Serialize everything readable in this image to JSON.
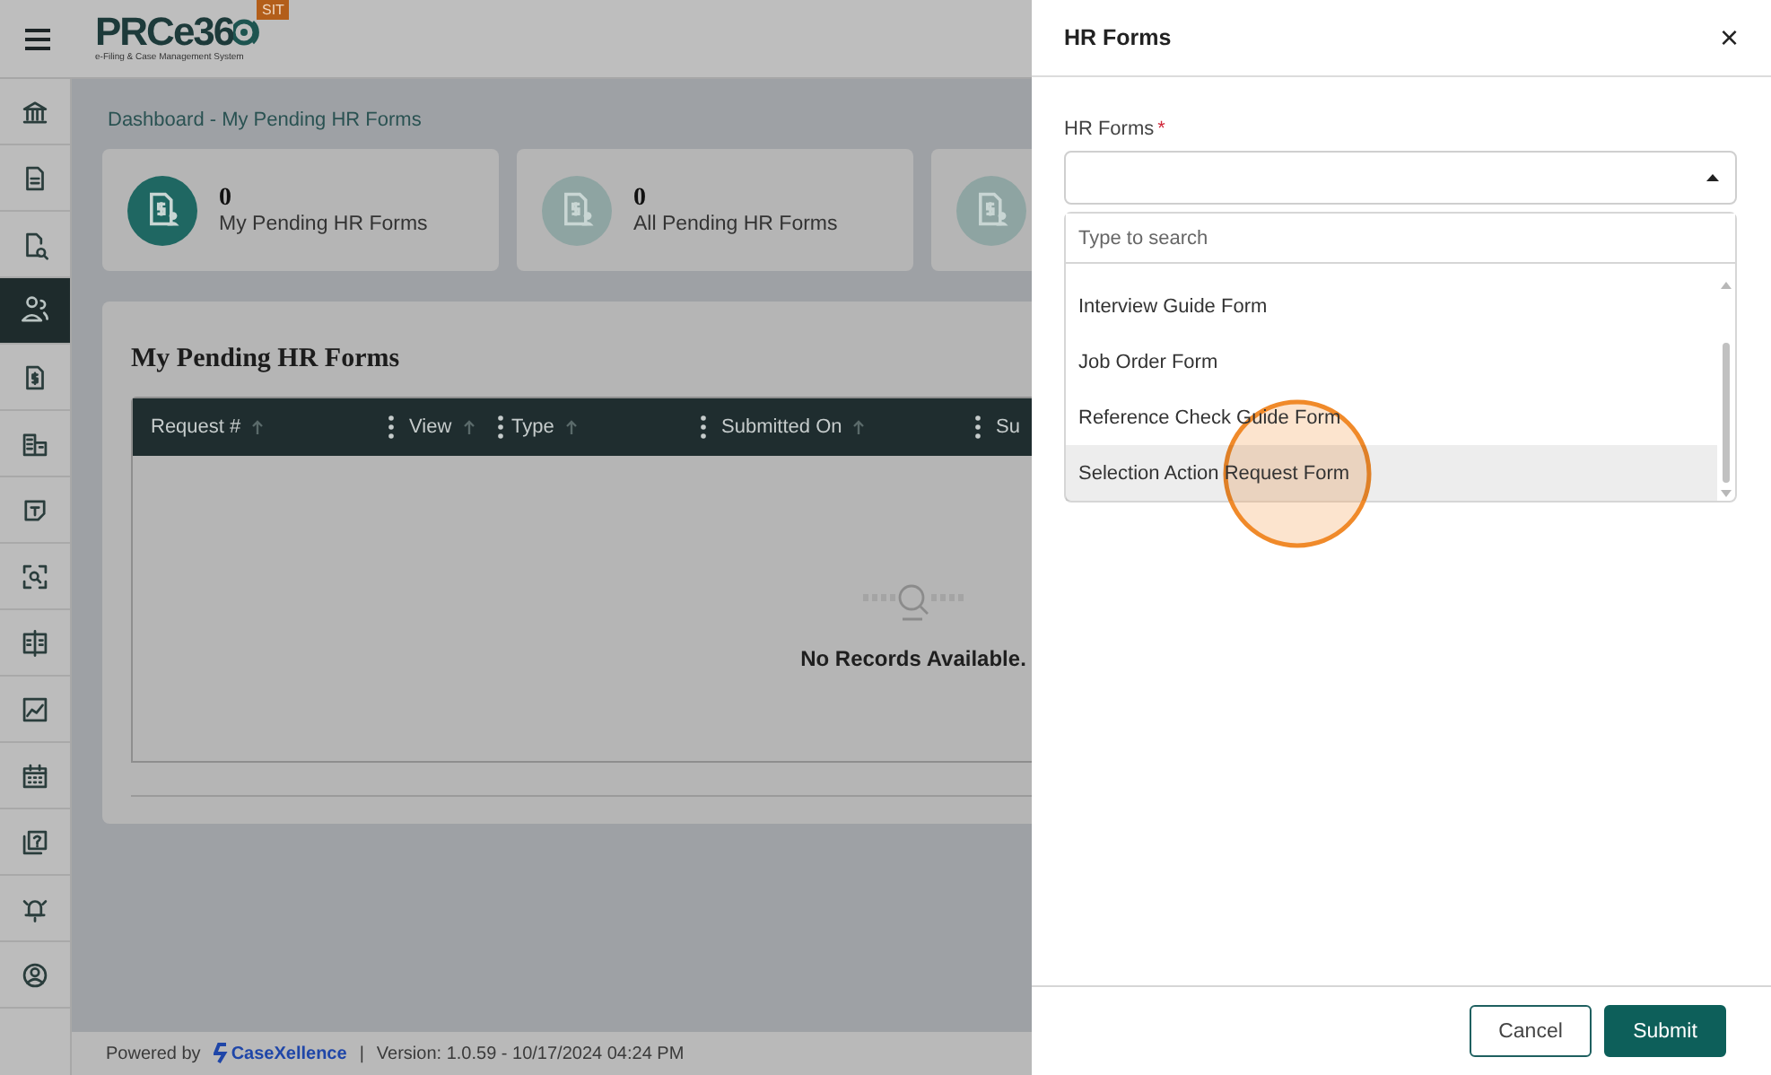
{
  "header": {
    "logo": "PRCe36",
    "logo_sub": "e-Filing & Case Management System",
    "env_badge": "SIT"
  },
  "sidebar": {
    "items": [
      {
        "kind": "bank",
        "selected": false
      },
      {
        "kind": "document",
        "selected": false
      },
      {
        "kind": "document-search",
        "selected": false
      },
      {
        "kind": "people",
        "selected": true
      },
      {
        "kind": "money-document",
        "selected": false
      },
      {
        "kind": "building",
        "selected": false
      },
      {
        "kind": "note",
        "selected": false
      },
      {
        "kind": "scan",
        "selected": false
      },
      {
        "kind": "book",
        "selected": false
      },
      {
        "kind": "chart",
        "selected": false
      },
      {
        "kind": "calendar",
        "selected": false
      },
      {
        "kind": "help",
        "selected": false
      },
      {
        "kind": "alarm",
        "selected": false
      },
      {
        "kind": "user",
        "selected": false
      }
    ]
  },
  "breadcrumb": "Dashboard - My Pending HR Forms",
  "stat_cards": [
    {
      "count": "0",
      "label": "My Pending HR Forms",
      "selected": true
    },
    {
      "count": "0",
      "label": "All Pending HR Forms",
      "selected": false
    },
    {
      "selected": false
    }
  ],
  "panel": {
    "title": "My Pending HR Forms",
    "columns": [
      {
        "label": "Request #"
      },
      {
        "label": "View"
      },
      {
        "label": "Type"
      },
      {
        "label": "Submitted On"
      },
      {
        "label": "Su"
      }
    ],
    "empty_message": "No Records Available."
  },
  "footer": {
    "powered_by": "Powered by",
    "brand": "CaseXellence",
    "separator": "|",
    "version": "Version: 1.0.59 - 10/17/2024 04:24 PM"
  },
  "drawer": {
    "title": "HR Forms",
    "close": "×",
    "field_label": "HR Forms",
    "required_mark": "*",
    "search_placeholder": "Type to search",
    "options": [
      {
        "label": "Interview Guide Form",
        "selected": false
      },
      {
        "label": "Job Order Form",
        "selected": false
      },
      {
        "label": "Reference Check Guide Form",
        "selected": false
      },
      {
        "label": "Selection Action Request Form",
        "selected": true
      }
    ],
    "buttons": [
      {
        "label": "Cancel",
        "kind": "secondary"
      },
      {
        "label": "Submit",
        "kind": "primary"
      }
    ]
  }
}
